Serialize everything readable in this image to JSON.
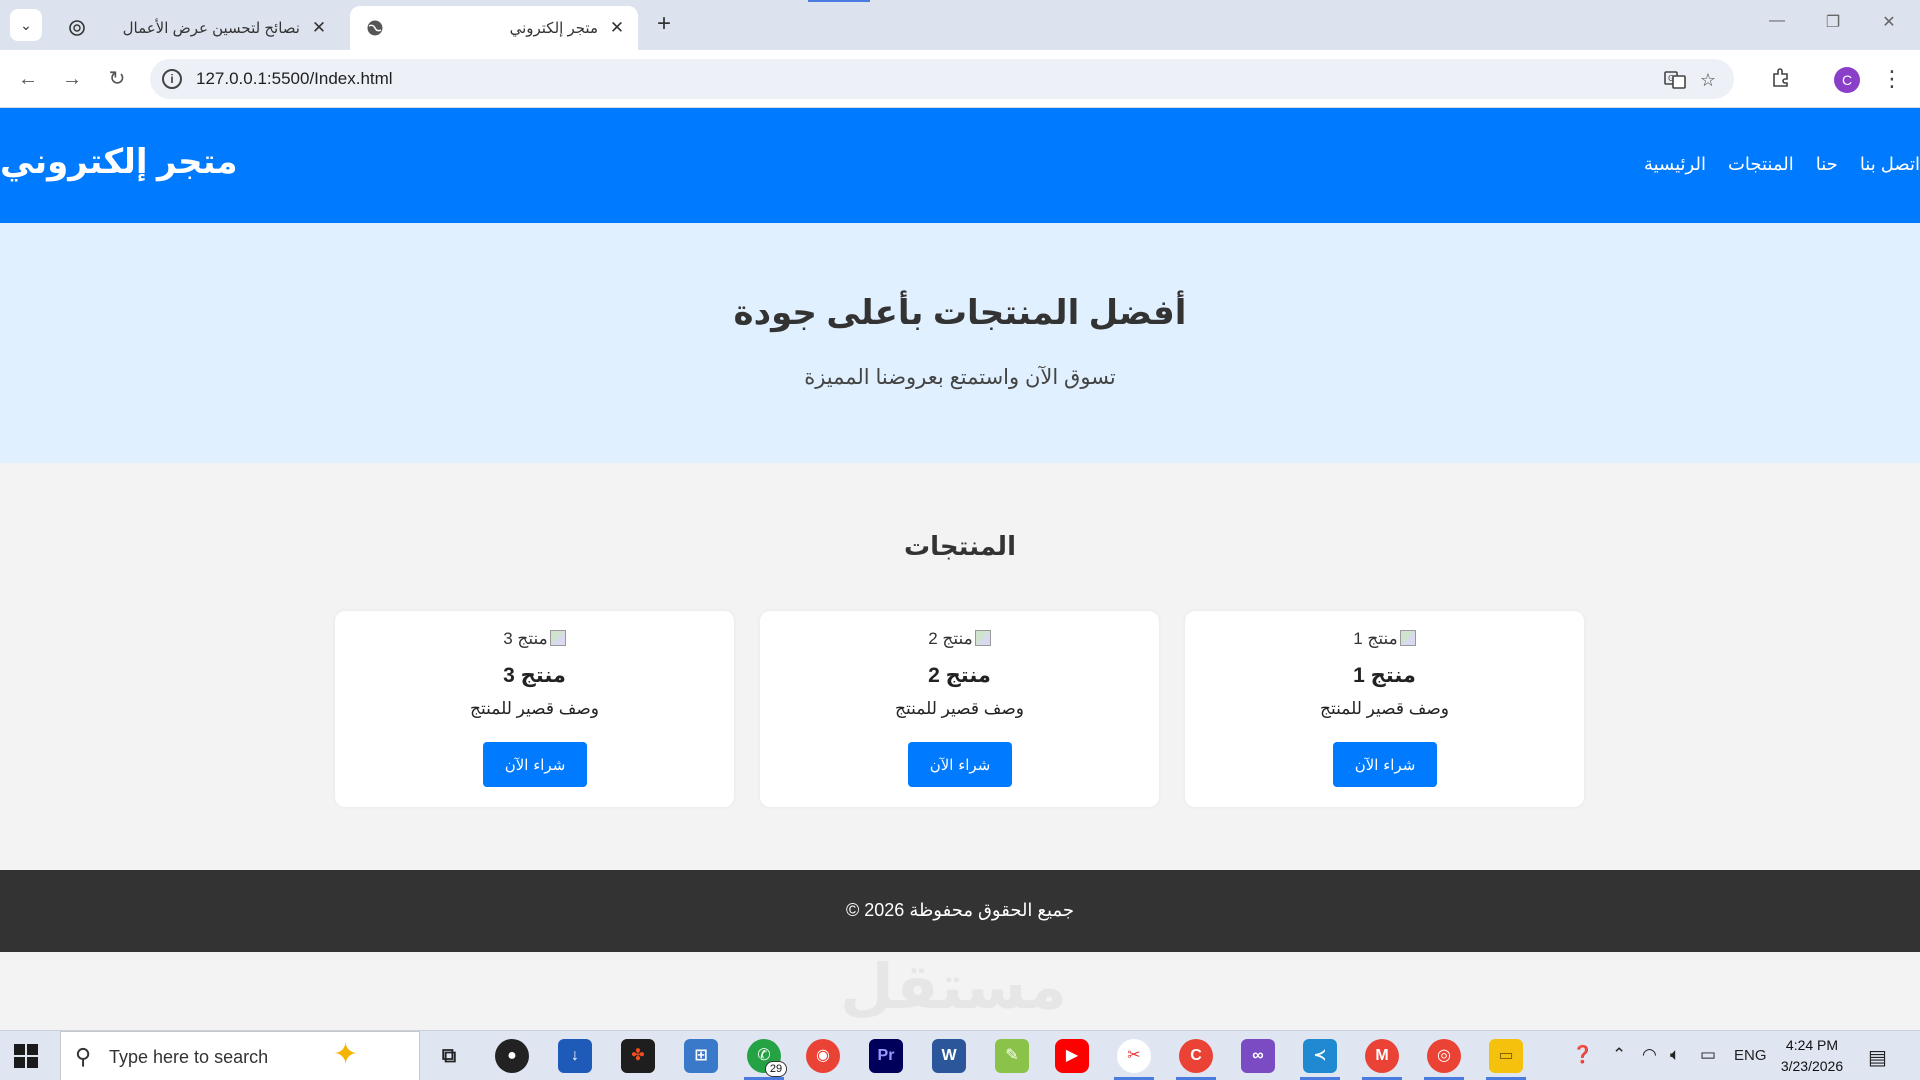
{
  "browser": {
    "tabs": [
      {
        "title": "نصائح لتحسين عرض الأعمال",
        "active": false
      },
      {
        "title": "متجر إلكتروني",
        "active": true
      }
    ],
    "url": "127.0.0.1:5500/Index.html"
  },
  "site": {
    "logo": "متجر إلكتروني",
    "nav": [
      "الرئيسية",
      "المنتجات",
      "حنا",
      "اتصل بنا"
    ],
    "hero_title": "أفضل المنتجات بأعلى جودة",
    "hero_subtitle": "تسوق الآن واستمتع بعروضنا المميزة",
    "products_heading": "المنتجات",
    "products": [
      {
        "img_alt": "منتج 1",
        "title": "منتج 1",
        "description": "وصف قصير للمنتج",
        "button": "شراء الآن"
      },
      {
        "img_alt": "منتج 2",
        "title": "منتج 2",
        "description": "وصف قصير للمنتج",
        "button": "شراء الآن"
      },
      {
        "img_alt": "منتج 3",
        "title": "منتج 3",
        "description": "وصف قصير للمنتج",
        "button": "شراء الآن"
      }
    ],
    "footer": "جميع الحقوق محفوظة 2026 ©"
  },
  "watermark": "مستقل",
  "taskbar": {
    "search_placeholder": "Type here to search",
    "whatsapp_badge": "29",
    "language": "ENG",
    "time": "4:24 PM",
    "date": "3/23/2026"
  },
  "colors": {
    "primary": "#007bff",
    "hero_bg": "#e1f0ff",
    "footer_bg": "#333333",
    "page_bg": "#f3f3f3"
  }
}
